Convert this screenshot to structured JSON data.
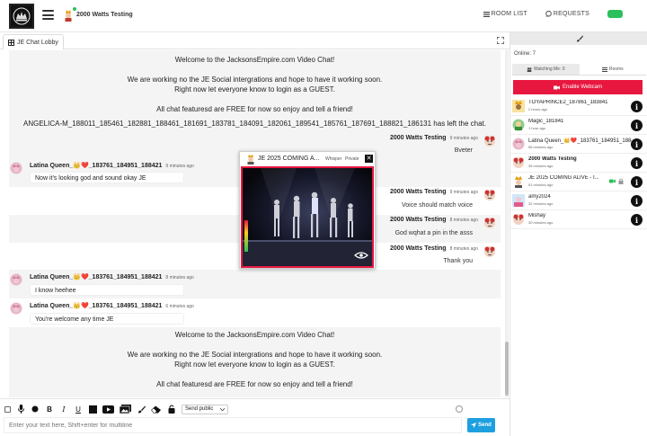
{
  "header": {
    "room_name": "2000 Watts Testing",
    "room_list_label": "ROOM LIST",
    "requests_label": "REQUESTS",
    "toggle_color": "#2ec05c"
  },
  "tab": {
    "label": "JE Chat Lobby"
  },
  "chat": {
    "system_top": [
      "Welcome to the JacksonsEmpire.com Video Chat!",
      "We are working no the JE Social intergrations and hope to have it working soon.",
      "Right now let everyone know to login as a GUEST.",
      "All chat featuresd are FREE for now so enjoy and tell a friend!"
    ],
    "left_notice": "ANGELICA-M_188011_185461_182881_188461_181691_183781_184091_182061_189541_185761_187691_188821_186131 has left the chat.",
    "messages": [
      {
        "side": "right",
        "name": "2000 Watts Testing",
        "time": "9 minutes ago",
        "text": "Bveter"
      },
      {
        "side": "left",
        "name": "Latina Queen_👑❤️_183761_184951_188421",
        "time": "9 minutes ago",
        "text": "Now it's looking god and sound okay JE"
      },
      {
        "side": "right",
        "name": "2000 Watts Testing",
        "time": "9 minutes ago",
        "text": "Voice should match voice"
      },
      {
        "side": "right",
        "name": "2000 Watts Testing",
        "time": "8 minutes ago",
        "text": "God wqhat a pin in the asss"
      },
      {
        "side": "right",
        "name": "2000 Watts Testing",
        "time": "8 minutes ago",
        "text": "Thank you"
      },
      {
        "side": "left",
        "name": "Latina Queen_👑❤️_183761_184951_188421",
        "time": "8 minutes ago",
        "text": "I know heehee"
      },
      {
        "side": "left",
        "name": "Latina Queen_👑❤️_183761_184951_188421",
        "time": "6 minutes ago",
        "text": "You're welcome any time JE"
      }
    ],
    "system_bottom": [
      "Welcome to the JacksonsEmpire.com Video Chat!",
      "We are working no the JE Social intergrations and hope to have it working soon.",
      "Right now let everyone know to login as a GUEST.",
      "All chat featuresd are FREE for now so enjoy and tell a friend!"
    ]
  },
  "popup": {
    "title": "JE 2025 COMING A...",
    "whisper_label": "Whisper",
    "private_label": "Private",
    "close_label": "✕"
  },
  "sidebar": {
    "online_label": "Online: 7",
    "tab_watching": "Watching Me: 0",
    "tab_rooms": "Rooms",
    "webcam_label": "Enable Webcam",
    "webcam_color": "#e8173f",
    "users": [
      {
        "name": "TOYAPRINCE2_187861_183841",
        "time": "2 hours ago",
        "bold": false
      },
      {
        "name": "Magic_181841",
        "time": "1 hour ago",
        "bold": false
      },
      {
        "name": "Latina Queen_👑❤️_183761_184951_188421",
        "time": "56 minutes ago",
        "bold": false
      },
      {
        "name": "2000 Watts Testing",
        "time": "35 minutes ago",
        "bold": true
      },
      {
        "name": "JE 2025 COMING ALIVE - I...",
        "time": "51 minutes ago",
        "bold": false
      },
      {
        "name": "amy2024",
        "time": "32 minutes ago",
        "bold": false
      },
      {
        "name": "Mishay",
        "time": "30 minutes ago",
        "bold": false
      }
    ]
  },
  "composer": {
    "placeholder": "Enter your text here, Shift+enter for multiline",
    "send_public": "Send public",
    "send_label": "Send",
    "send_color": "#1e9fe0"
  }
}
